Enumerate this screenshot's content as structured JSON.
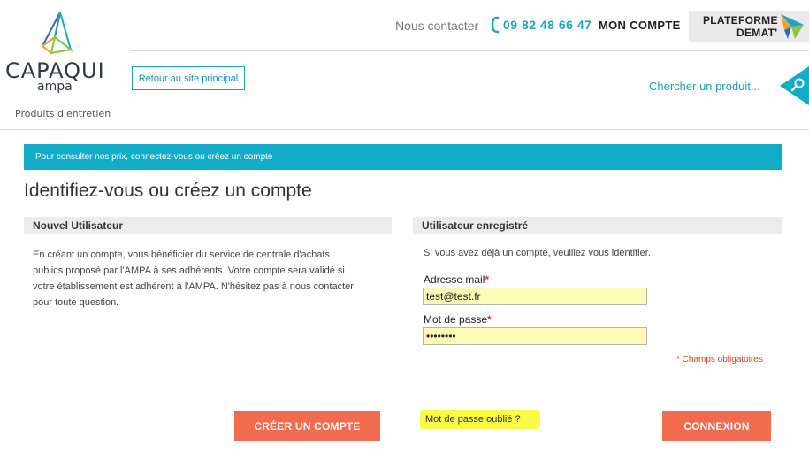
{
  "header": {
    "logo_name": "CAPAQUI",
    "logo_sub": "ampa",
    "tagline": "Produits d'entretien",
    "back_label": "Retour au site principal",
    "contact_label": "Nous contacter",
    "phone": "09 82 48 66 47",
    "account_label": "MON COMPTE",
    "demat_line1": "PLATEFORME",
    "demat_line2": "DEMAT'",
    "search_placeholder": "Chercher un produit..."
  },
  "notice": "Pour consulter nos prix, connectez-vous ou créez un compte",
  "page_title": "Identifiez-vous ou créez un compte",
  "new_user": {
    "heading": "Nouvel Utilisateur",
    "text": "En créant un compte, vous bénéficier du service de centrale d'achats publics proposé par l'AMPA à ses adhérents. Votre compte sera validé si votre établissement est adhérent à l'AMPA. N'hésitez pas à nous contacter pour toute question.",
    "create_button": "CRÉER UN COMPTE"
  },
  "registered": {
    "heading": "Utilisateur enregistré",
    "intro": "Si vous avez déjà un compte, veuillez vous identifier.",
    "email_label": "Adresse mail",
    "email_value": "test@test.fr",
    "password_label": "Mot de passe",
    "password_value": "password",
    "required_marker": "*",
    "required_note": "* Champs obligatoires",
    "forgot_label": "Mot de passe oublié ?",
    "login_button": "CONNEXION"
  },
  "colors": {
    "accent": "#13acc8",
    "button": "#f26b4e",
    "field_bg": "#fbfbb7",
    "highlight": "#fbfb45"
  },
  "icons": {
    "logo": "capaqui-logo-icon",
    "phone": "phone-icon",
    "demat": "demat-bird-icon",
    "search": "search-icon"
  }
}
